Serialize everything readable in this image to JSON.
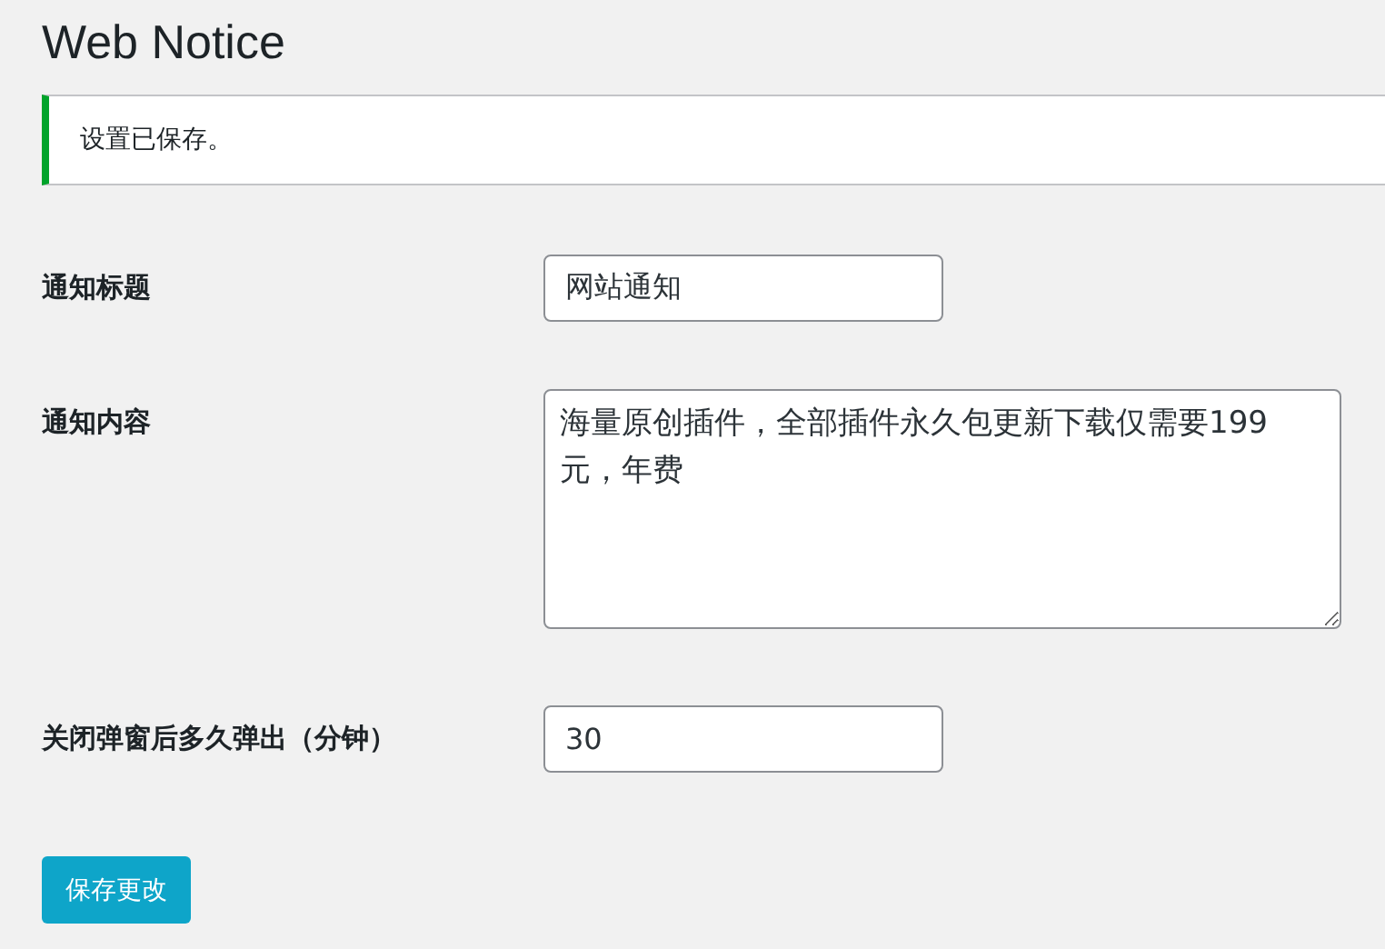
{
  "page_title": "Web Notice",
  "notice": {
    "success": true,
    "message": "设置已保存。"
  },
  "fields": [
    {
      "kind": "text",
      "label": "通知标题",
      "value": "网站通知"
    },
    {
      "kind": "textarea",
      "label": "通知内容",
      "value": "海量原创插件，全部插件永久包更新下载仅需要199元，年费"
    },
    {
      "kind": "text",
      "label": "关闭弹窗后多久弹出（分钟）",
      "value": "30"
    }
  ],
  "submit_button": "保存更改"
}
